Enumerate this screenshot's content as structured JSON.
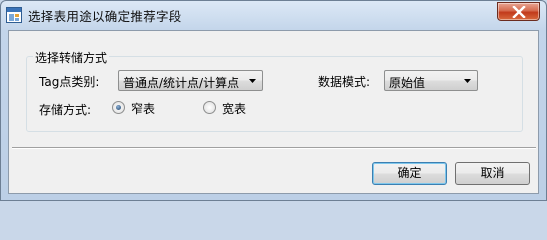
{
  "window": {
    "title": "选择表用途以确定推荐字段",
    "icon": "app-table-icon",
    "close_icon": "close-x-icon"
  },
  "group": {
    "title": "选择转储方式",
    "tag_type": {
      "label": "Tag点类别:",
      "selected": "普通点/统计点/计算点"
    },
    "data_mode": {
      "label": "数据模式:",
      "selected": "原始值"
    },
    "storage": {
      "label": "存储方式:",
      "options": [
        {
          "label": "窄表",
          "checked": true
        },
        {
          "label": "宽表",
          "checked": false
        }
      ]
    }
  },
  "buttons": {
    "ok": "确定",
    "cancel": "取消"
  }
}
